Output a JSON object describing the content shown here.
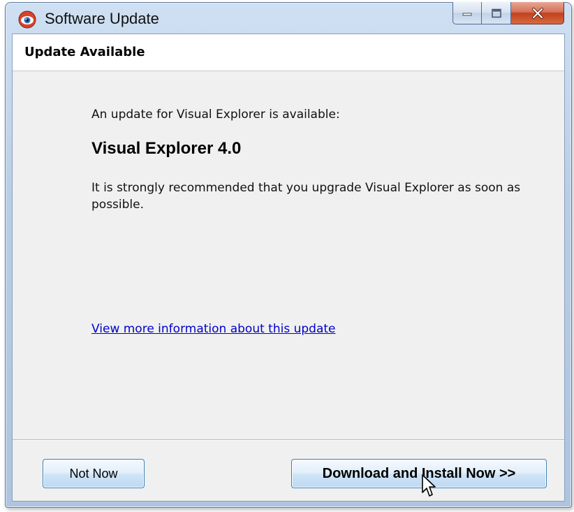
{
  "window": {
    "title": "Software Update",
    "controls": {
      "minimize": "minimize-icon",
      "maximize": "maximize-icon",
      "close": "close-icon"
    }
  },
  "header": {
    "title": "Update Available"
  },
  "body": {
    "intro": "An update for Visual Explorer is available:",
    "product": "Visual Explorer 4.0",
    "recommendation": "It is strongly recommended that you upgrade Visual Explorer as soon as possible.",
    "more_info_link": "View more information about this update"
  },
  "footer": {
    "not_now_label": "Not Now",
    "download_label": "Download and Install Now >>"
  },
  "colors": {
    "link": "#0000cc",
    "button_border": "#3c7fb1",
    "close_button": "#c1411f"
  }
}
